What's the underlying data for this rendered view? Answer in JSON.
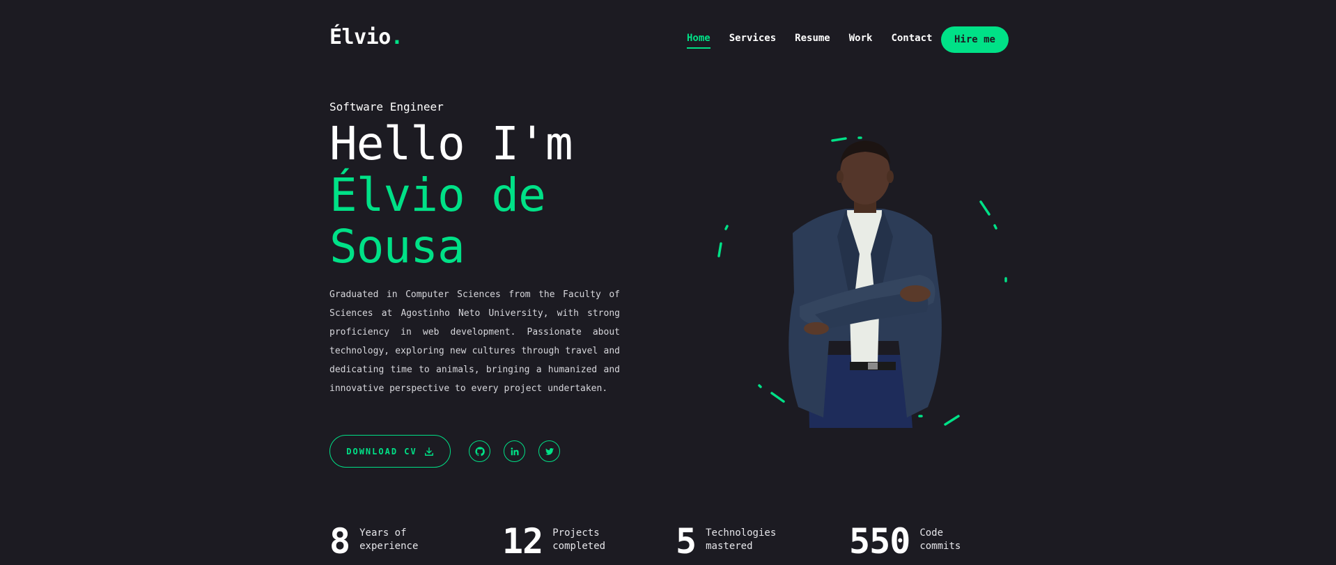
{
  "brand": {
    "name": "Élvio",
    "dot": "."
  },
  "nav": {
    "items": [
      {
        "label": "Home",
        "active": true
      },
      {
        "label": "Services",
        "active": false
      },
      {
        "label": "Resume",
        "active": false
      },
      {
        "label": "Work",
        "active": false
      },
      {
        "label": "Contact",
        "active": false
      }
    ],
    "hire_label": "Hire me"
  },
  "hero": {
    "role": "Software Engineer",
    "greeting": "Hello I'm",
    "name_line1": "Élvio de",
    "name_line2": "Sousa",
    "bio": "Graduated in Computer Sciences from the Faculty of Sciences at Agostinho Neto University, with strong proficiency in web development. Passionate about technology, exploring new cultures through travel and dedicating time to animals, bringing a humanized and innovative perspective to every project undertaken.",
    "cv_label": "DOWNLOAD CV",
    "socials": [
      {
        "icon": "github-icon"
      },
      {
        "icon": "linkedin-icon"
      },
      {
        "icon": "twitter-icon"
      }
    ]
  },
  "stats": [
    {
      "value": "8",
      "label": "Years of experience"
    },
    {
      "value": "12",
      "label": "Projects completed"
    },
    {
      "value": "5",
      "label": "Technologies mastered"
    },
    {
      "value": "550",
      "label": "Code commits"
    }
  ],
  "colors": {
    "accent": "#00e187",
    "background": "#1c1b22"
  }
}
